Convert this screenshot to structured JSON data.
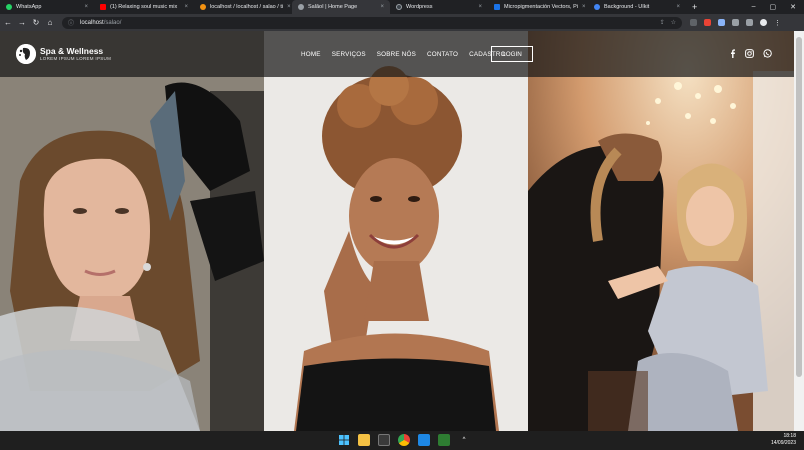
{
  "browser": {
    "tabs": [
      {
        "label": "WhatsApp",
        "color": "#25d366",
        "active": false
      },
      {
        "label": "(1) Relaxing soul music mix",
        "color": "#ff0000",
        "active": false
      },
      {
        "label": "localhost / localhost / salao / ti",
        "color": "#f29111",
        "active": false
      },
      {
        "label": "SalãoI | Home Page",
        "color": "#9aa0a6",
        "active": true
      },
      {
        "label": "Wordpress",
        "color": "#3c434a",
        "active": false
      },
      {
        "label": "Micropigmentación Vectors, Pi",
        "color": "#1a73e8",
        "active": false
      },
      {
        "label": "Background - UIkit",
        "color": "#4285f4",
        "active": false
      }
    ],
    "new_tab": "+",
    "url_host": "localhost",
    "url_path": "/salao/"
  },
  "site": {
    "brand": "Spa & Wellness",
    "tagline": "LOREM IPSUM LOREM IPSUM",
    "menu": [
      "HOME",
      "SERVIÇOS",
      "SOBRE NÓS",
      "CONTATO",
      "CADASTRO"
    ],
    "login": "LOGIN",
    "social": [
      "facebook-icon",
      "instagram-icon",
      "whatsapp-icon"
    ]
  },
  "taskbar": {
    "time": "18:18",
    "date": "14/09/2023"
  }
}
